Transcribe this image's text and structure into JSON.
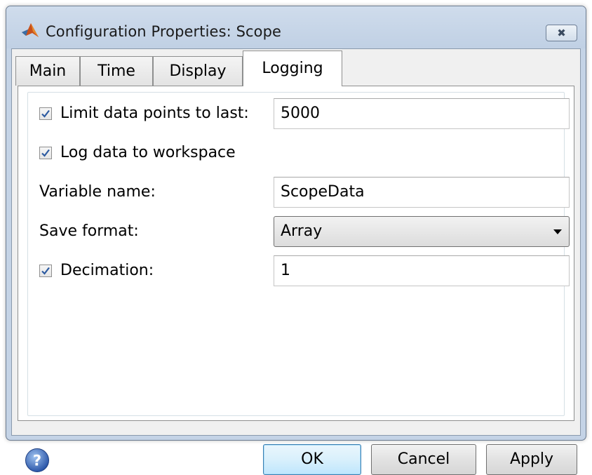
{
  "window": {
    "title": "Configuration Properties: Scope"
  },
  "tabs": [
    {
      "label": "Main"
    },
    {
      "label": "Time"
    },
    {
      "label": "Display"
    },
    {
      "label": "Logging"
    }
  ],
  "active_tab": "Logging",
  "logging": {
    "limit_points": {
      "label": "Limit data points to last:",
      "checked": true,
      "value": "5000"
    },
    "log_to_workspace": {
      "label": "Log data to workspace",
      "checked": true
    },
    "variable_name": {
      "label": "Variable name:",
      "value": "ScopeData"
    },
    "save_format": {
      "label": "Save format:",
      "value": "Array"
    },
    "decimation": {
      "label": "Decimation:",
      "checked": true,
      "value": "1"
    }
  },
  "buttons": {
    "ok": "OK",
    "cancel": "Cancel",
    "apply": "Apply"
  },
  "icons": {
    "app": "matlab-logo-icon",
    "close": "close-icon",
    "help": "help-icon"
  },
  "colors": {
    "accent": "#3c7fb1",
    "checkmark": "#2c5aa0",
    "title_bar": "#c4d3e6"
  }
}
